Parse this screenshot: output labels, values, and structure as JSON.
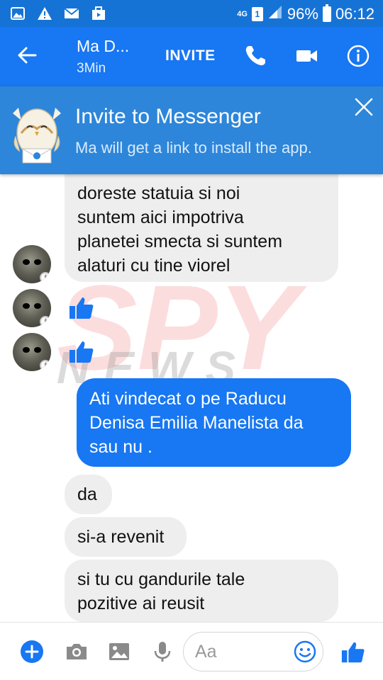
{
  "status_bar": {
    "network": "4G",
    "sim": "1",
    "battery": "96%",
    "time": "06:12"
  },
  "header": {
    "contact_name": "Ma D...",
    "contact_status": "3Min",
    "invite_label": "INVITE",
    "icons": [
      "back-arrow-icon",
      "phone-icon",
      "video-camera-icon",
      "info-icon"
    ]
  },
  "banner": {
    "title": "Invite to Messenger",
    "subtitle": "Ma will get a link to install the app."
  },
  "messages": [
    {
      "direction": "incoming",
      "text": "doreste statuia si noi suntem aici impotriva planetei smecta si suntem alaturi cu tine viorel",
      "lines": [
        "doreste statuia si noi",
        "suntem aici impotriva",
        "planetei smecta si suntem",
        "alaturi cu tine viorel"
      ]
    },
    {
      "direction": "incoming",
      "type": "like"
    },
    {
      "direction": "incoming",
      "type": "like"
    },
    {
      "direction": "outgoing",
      "lines": [
        "Ati vindecat o pe Raducu",
        "Denisa Emilia Manelista da",
        "sau nu ."
      ]
    },
    {
      "direction": "incoming",
      "lines": [
        "da"
      ]
    },
    {
      "direction": "incoming",
      "lines": [
        "si-a revenit"
      ]
    },
    {
      "direction": "incoming",
      "lines": [
        "si tu cu gandurile tale",
        "pozitive ai reusit"
      ]
    }
  ],
  "watermark": {
    "line1": "SPY",
    "line2": "NEWS"
  },
  "composer": {
    "placeholder": "Aa"
  },
  "colors": {
    "status_bar": "#1673d6",
    "app_bar": "#1877f2",
    "banner": "#2d86d9",
    "outgoing_bubble": "#1877f2",
    "incoming_bubble": "#eeeeee"
  }
}
